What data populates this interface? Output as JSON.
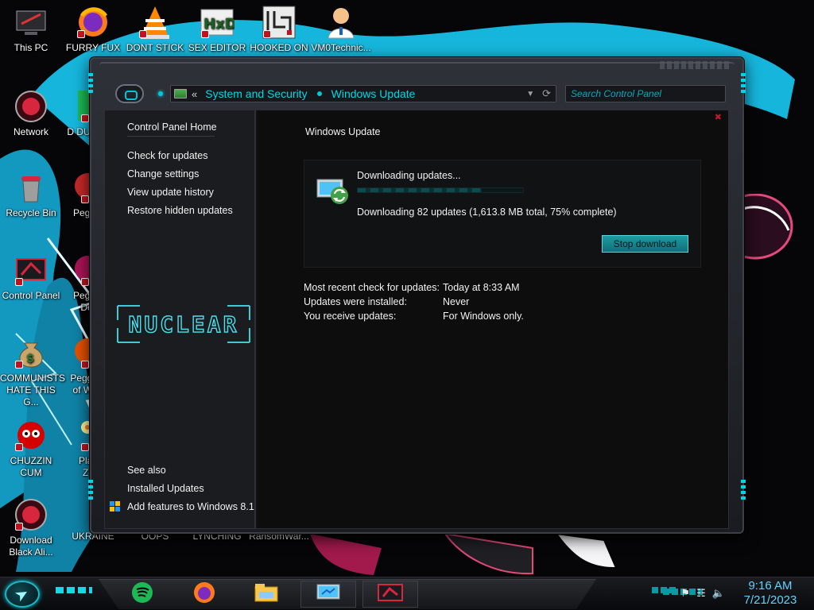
{
  "desktop": {
    "icons": [
      {
        "label": "This PC"
      },
      {
        "label": "FURRY FUX"
      },
      {
        "label": "DONT STICK"
      },
      {
        "label": "SEX EDITOR"
      },
      {
        "label": "HOOKED ON"
      },
      {
        "label": "VM0Technic..."
      },
      {
        "label": "Network"
      },
      {
        "label": "D DUM"
      },
      {
        "label": "Recycle Bin"
      },
      {
        "label": "Peggle"
      },
      {
        "label": "Control Panel"
      },
      {
        "label": "Peggle De"
      },
      {
        "label": "COMMUNISTS HATE THIS G..."
      },
      {
        "label": "Peggle of Wa"
      },
      {
        "label": "CHUZZIN CUM"
      },
      {
        "label": "Plan Zo"
      },
      {
        "label": "Download Black Ali..."
      },
      {
        "label": "UKRAINE"
      },
      {
        "label": "OOPS"
      },
      {
        "label": "LYNCHING"
      },
      {
        "label": "RansomWar..."
      }
    ]
  },
  "window": {
    "breadcrumb": [
      "System and Security",
      "Windows Update"
    ],
    "back_chevron": "«",
    "search_placeholder": "Search Control Panel",
    "sidebar": {
      "home": "Control Panel Home",
      "links": [
        "Check for updates",
        "Change settings",
        "View update history",
        "Restore hidden updates"
      ],
      "logo_text": "NUCLEAR",
      "see_also_title": "See also",
      "see_also": [
        "Installed Updates",
        "Add features to Windows 8.1"
      ]
    },
    "content": {
      "title": "Windows Update",
      "status": "Downloading updates...",
      "progress_fraction": 0.75,
      "detail": "Downloading 82 updates (1,613.8 MB total, 75% complete)",
      "stop_button": "Stop download",
      "info": [
        {
          "key": "Most recent check for updates:",
          "value": "Today at 8:33 AM"
        },
        {
          "key": "Updates were installed:",
          "value": "Never"
        },
        {
          "key": "You receive updates:",
          "value": "For Windows only."
        }
      ]
    }
  },
  "taskbar": {
    "apps": [
      "spotify-icon",
      "firefox-icon",
      "file-explorer-icon",
      "windows-update-icon",
      "control-panel-icon"
    ],
    "time": "9:16 AM",
    "date": "7/21/2023"
  },
  "colors": {
    "accent": "#00d8e8",
    "button": "#1d9ca3",
    "clock": "#5fd4ff"
  }
}
